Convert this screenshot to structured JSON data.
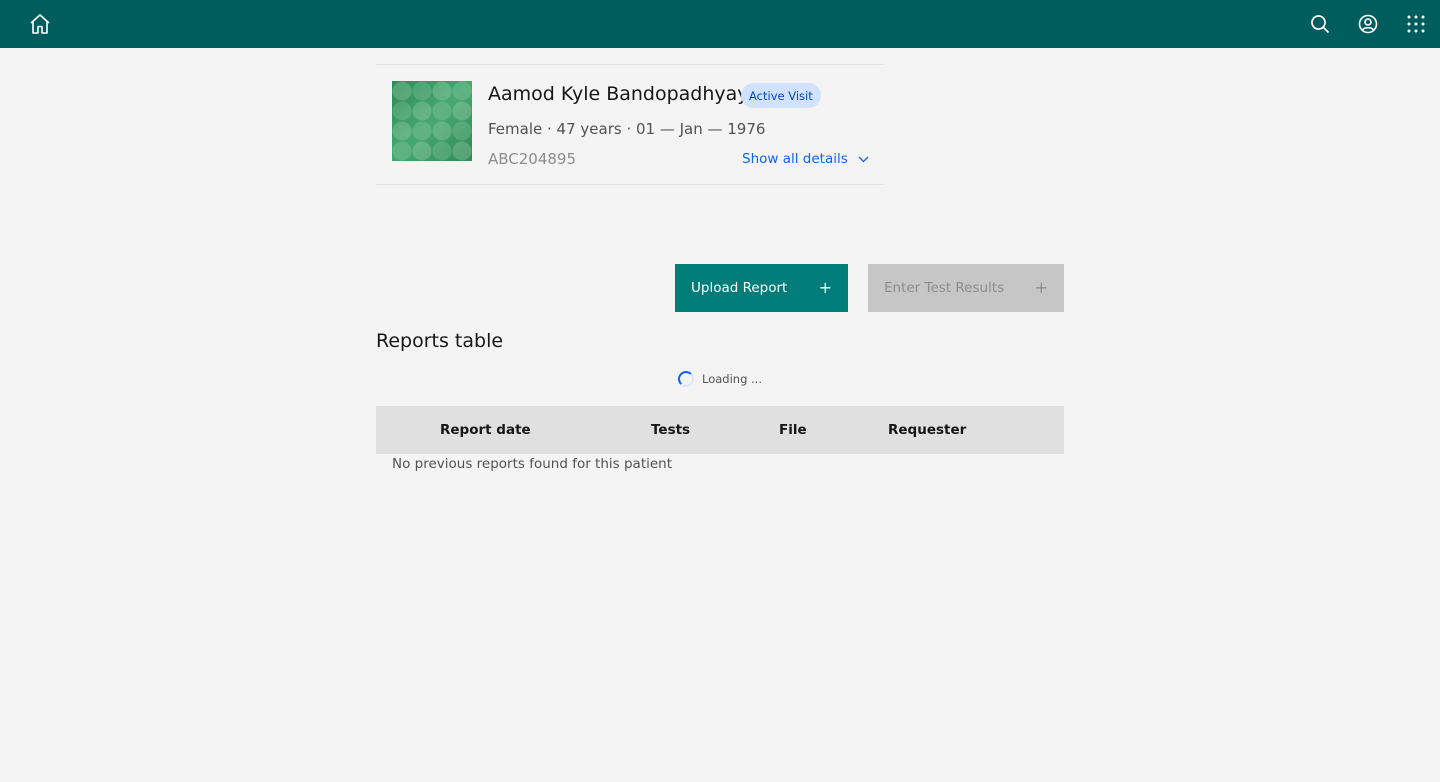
{
  "header": {
    "home_icon": "home-icon",
    "search_icon": "search-icon",
    "user_icon": "user-avatar-icon",
    "apps_icon": "app-switcher-icon",
    "background": "#005d5d"
  },
  "patient": {
    "name": "Aamod Kyle Bandopadhyay",
    "visit_tag": "Active Visit",
    "demographics": "Female · 47 years · 01 — Jan — 1976",
    "identifier": "ABC204895",
    "show_details_label": "Show all details"
  },
  "actions": {
    "upload_label": "Upload Report",
    "enter_results_label": "Enter Test Results",
    "plus_symbol": "+",
    "upload_color": "#007d79",
    "disabled_color": "#c6c6c6"
  },
  "reports": {
    "title": "Reports table",
    "loading_text": "Loading ...",
    "columns": [
      "Report date",
      "Tests",
      "File",
      "Requester"
    ],
    "empty_message": "No previous reports found for this patient"
  }
}
